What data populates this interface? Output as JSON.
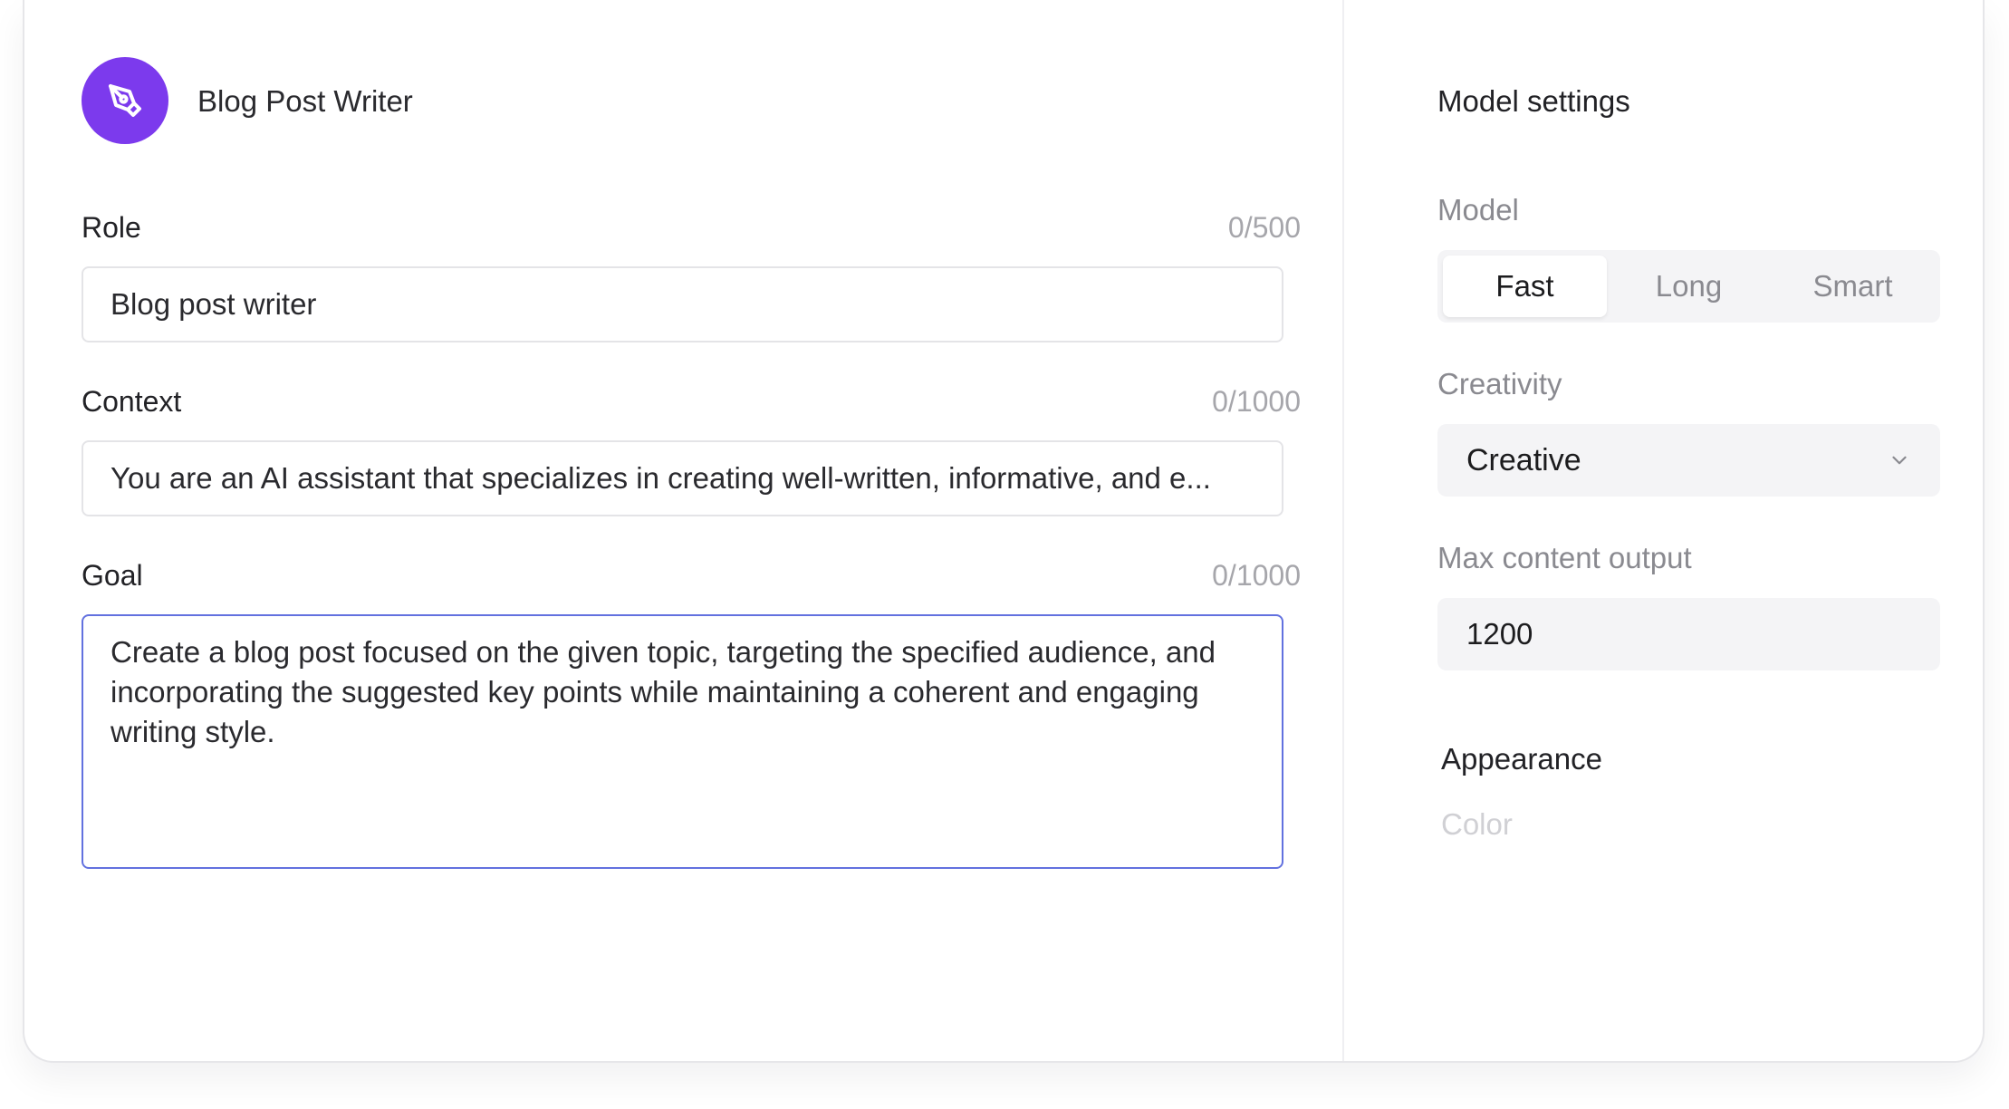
{
  "app": {
    "title": "Blog Post Writer",
    "icon": "pen-nib-icon",
    "accent_color": "#7c3aed"
  },
  "fields": {
    "role": {
      "label": "Role",
      "counter": "0/500",
      "value": "Blog post writer"
    },
    "context": {
      "label": "Context",
      "counter": "0/1000",
      "value": "You are an AI assistant that specializes in creating well-written, informative, and e..."
    },
    "goal": {
      "label": "Goal",
      "counter": "0/1000",
      "value": "Create a blog post focused on the given topic, targeting the specified audience, and incorporating the suggested key points while maintaining a coherent and engaging writing style.",
      "focus_border_color": "#6271df"
    }
  },
  "settings": {
    "title": "Model settings",
    "model": {
      "label": "Model",
      "options": [
        "Fast",
        "Long",
        "Smart"
      ],
      "selected": "Fast"
    },
    "creativity": {
      "label": "Creativity",
      "value": "Creative",
      "icon": "chevron-down-icon"
    },
    "max_output": {
      "label": "Max content output",
      "value": "1200"
    },
    "appearance": {
      "title": "Appearance",
      "color_label": "Color"
    }
  }
}
